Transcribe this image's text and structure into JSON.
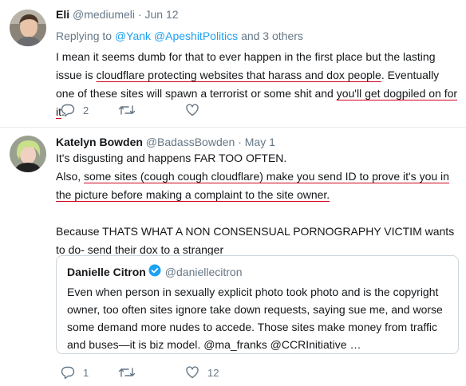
{
  "tweet1": {
    "name": "Eli",
    "handle": "@mediumeli",
    "separator": "·",
    "date": "Jun 12",
    "reply_prefix": "Replying to",
    "reply_users": "@Yank @ApeshitPolitics",
    "reply_suffix": "and 3 others",
    "text_part1": "I mean it seems dumb for that to ever happen in the first place but the lasting issue is ",
    "text_highlight1": "cloudflare protecting websites that harass and dox people",
    "text_part2": ". Eventually one of these sites will spawn a terrorist or some shit and ",
    "text_highlight2": "you'll get dogpiled on for it",
    "text_part3": ".",
    "reply_count": "2",
    "retweet_count": "",
    "like_count": ""
  },
  "tweet2": {
    "name": "Katelyn Bowden",
    "handle": "@BadassBowden",
    "separator": "·",
    "date": "May 1",
    "line1": "It's disgusting and happens FAR TOO OFTEN.",
    "line2_prefix": "Also, ",
    "line2_highlight": "some sites (cough cough cloudflare) make you send ID to prove it's you in the picture before making a complaint to the site owner.",
    "line3": "Because THATS WHAT A NON CONSENSUAL PORNOGRAPHY VICTIM wants to do- send their dox to a stranger",
    "reply_count": "1",
    "retweet_count": "",
    "like_count": "12"
  },
  "quote": {
    "name": "Danielle Citron",
    "handle": "@daniellecitron",
    "text": "Even when person in sexually explicit photo took photo and is the copyright owner, too often sites ignore take down requests, saying sue me, and worse some demand more nudes to accede. Those sites make money from traffic and buses—it is biz model. @ma_franks @CCRInitiative …"
  },
  "colors": {
    "link": "#1da1f2",
    "muted": "#657786",
    "underline": "#d0021b",
    "verified": "#1da1f2"
  },
  "icons": [
    "reply-icon",
    "retweet-icon",
    "like-icon",
    "verified-badge-icon"
  ]
}
